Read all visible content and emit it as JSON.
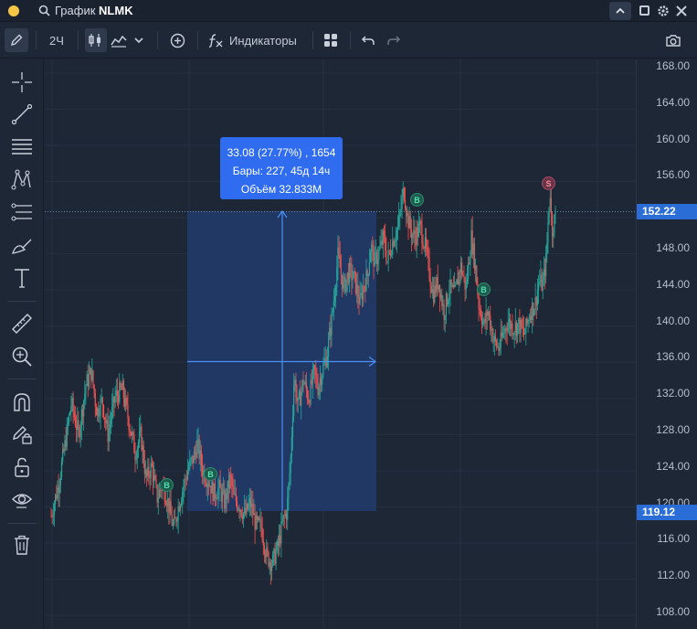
{
  "titlebar": {
    "title_prefix": "График",
    "symbol": "NLMK"
  },
  "toolbar": {
    "interval": "2Ч",
    "indicators_label": "Индикаторы"
  },
  "price_axis": {
    "ticks": [
      "168.00",
      "164.00",
      "160.00",
      "156.00",
      "152.00",
      "148.00",
      "144.00",
      "140.00",
      "136.00",
      "132.00",
      "128.00",
      "124.00",
      "120.00",
      "116.00",
      "112.00",
      "108.00"
    ],
    "current_price": "152.22",
    "measure_low_price": "119.12"
  },
  "measure": {
    "line1": "33.08 (27.77%) , 1654",
    "line2": "Бары: 227, 45д 14ч",
    "line3": "Объём 32.833M"
  },
  "markers": [
    {
      "type": "buy",
      "label": "B"
    },
    {
      "type": "buy",
      "label": "B"
    },
    {
      "type": "buy",
      "label": "B"
    },
    {
      "type": "buy",
      "label": "B"
    },
    {
      "type": "sell",
      "label": "S"
    }
  ],
  "colors": {
    "background": "#1e2735",
    "up_candle": "#26a69a",
    "down_candle": "#ef5350",
    "accent": "#2f6cf0",
    "measure_fill": "#213c6b"
  },
  "chart_data": {
    "type": "candlestick",
    "ylim": [
      106.5,
      169.5
    ],
    "current_price": 152.22,
    "measure_range": {
      "from": 119.12,
      "to": 152.2,
      "change": 33.08,
      "change_pct": 27.77,
      "bars": 227,
      "volume": "32.833M"
    },
    "close_path": [
      [
        0,
        119.0
      ],
      [
        8,
        122.5
      ],
      [
        15,
        126.8
      ],
      [
        22,
        131.5
      ],
      [
        30,
        128.0
      ],
      [
        38,
        133.5
      ],
      [
        44,
        135.0
      ],
      [
        50,
        130.5
      ],
      [
        56,
        131.8
      ],
      [
        62,
        128.0
      ],
      [
        70,
        132.2
      ],
      [
        78,
        133.0
      ],
      [
        85,
        129.5
      ],
      [
        92,
        126.0
      ],
      [
        98,
        128.0
      ],
      [
        104,
        123.0
      ],
      [
        110,
        124.5
      ],
      [
        116,
        121.0
      ],
      [
        122,
        122.5
      ],
      [
        128,
        120.5
      ],
      [
        134,
        117.5
      ],
      [
        138,
        119.5
      ],
      [
        144,
        122.0
      ],
      [
        150,
        124.2
      ],
      [
        156,
        125.5
      ],
      [
        160,
        127.0
      ],
      [
        166,
        124.0
      ],
      [
        172,
        123.0
      ],
      [
        178,
        121.5
      ],
      [
        184,
        122.0
      ],
      [
        190,
        120.5
      ],
      [
        196,
        123.2
      ],
      [
        200,
        121.0
      ],
      [
        206,
        120.2
      ],
      [
        212,
        119.0
      ],
      [
        218,
        120.5
      ],
      [
        224,
        118.0
      ],
      [
        230,
        117.8
      ],
      [
        236,
        114.5
      ],
      [
        242,
        113.8
      ],
      [
        248,
        115.5
      ],
      [
        254,
        118.5
      ],
      [
        258,
        119.5
      ],
      [
        262,
        125.0
      ],
      [
        266,
        134.5
      ],
      [
        270,
        131.0
      ],
      [
        276,
        134.0
      ],
      [
        282,
        132.0
      ],
      [
        288,
        135.0
      ],
      [
        292,
        133.2
      ],
      [
        296,
        134.8
      ],
      [
        302,
        136.8
      ],
      [
        308,
        141.5
      ],
      [
        314,
        147.8
      ],
      [
        320,
        144.2
      ],
      [
        326,
        146.0
      ],
      [
        332,
        145.2
      ],
      [
        338,
        142.5
      ],
      [
        342,
        144.5
      ],
      [
        346,
        145.5
      ],
      [
        350,
        149.0
      ],
      [
        354,
        147.0
      ],
      [
        360,
        148.5
      ],
      [
        364,
        149.8
      ],
      [
        368,
        147.2
      ],
      [
        374,
        149.5
      ],
      [
        380,
        151.0
      ],
      [
        386,
        155.2
      ],
      [
        390,
        152.0
      ],
      [
        394,
        150.5
      ],
      [
        398,
        149.8
      ],
      [
        404,
        151.0
      ],
      [
        410,
        148.5
      ],
      [
        414,
        146.0
      ],
      [
        418,
        143.5
      ],
      [
        424,
        145.0
      ],
      [
        430,
        141.5
      ],
      [
        436,
        144.2
      ],
      [
        442,
        143.5
      ],
      [
        448,
        146.8
      ],
      [
        454,
        144.2
      ],
      [
        460,
        149.8
      ],
      [
        464,
        147.0
      ],
      [
        468,
        142.5
      ],
      [
        474,
        140.0
      ],
      [
        478,
        141.8
      ],
      [
        484,
        138.5
      ],
      [
        490,
        137.5
      ],
      [
        496,
        139.5
      ],
      [
        500,
        140.5
      ],
      [
        506,
        139.8
      ],
      [
        512,
        140.2
      ],
      [
        518,
        139.0
      ],
      [
        524,
        141.5
      ],
      [
        530,
        142.5
      ],
      [
        534,
        145.0
      ],
      [
        538,
        144.5
      ],
      [
        542,
        147.5
      ],
      [
        546,
        155.5
      ],
      [
        548,
        150.5
      ],
      [
        552,
        152.2
      ]
    ]
  }
}
